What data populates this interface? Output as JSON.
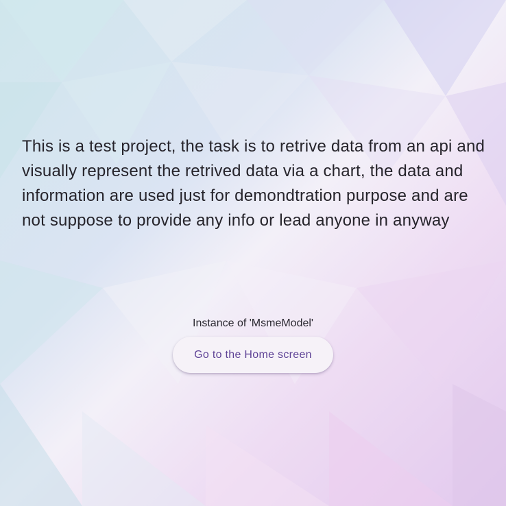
{
  "main": {
    "description": "This is a test project, the task is to retrive data from an api and visually represent the retrived data via a chart, the data and information are used just for demondtration purpose and are not suppose to provide any info or lead anyone in anyway",
    "instance_label": "Instance of 'MsmeModel'",
    "home_button_label": "Go to the Home screen"
  },
  "colors": {
    "text": "#26242b",
    "button_bg": "#f6f2f8",
    "button_text": "#5f4396"
  }
}
